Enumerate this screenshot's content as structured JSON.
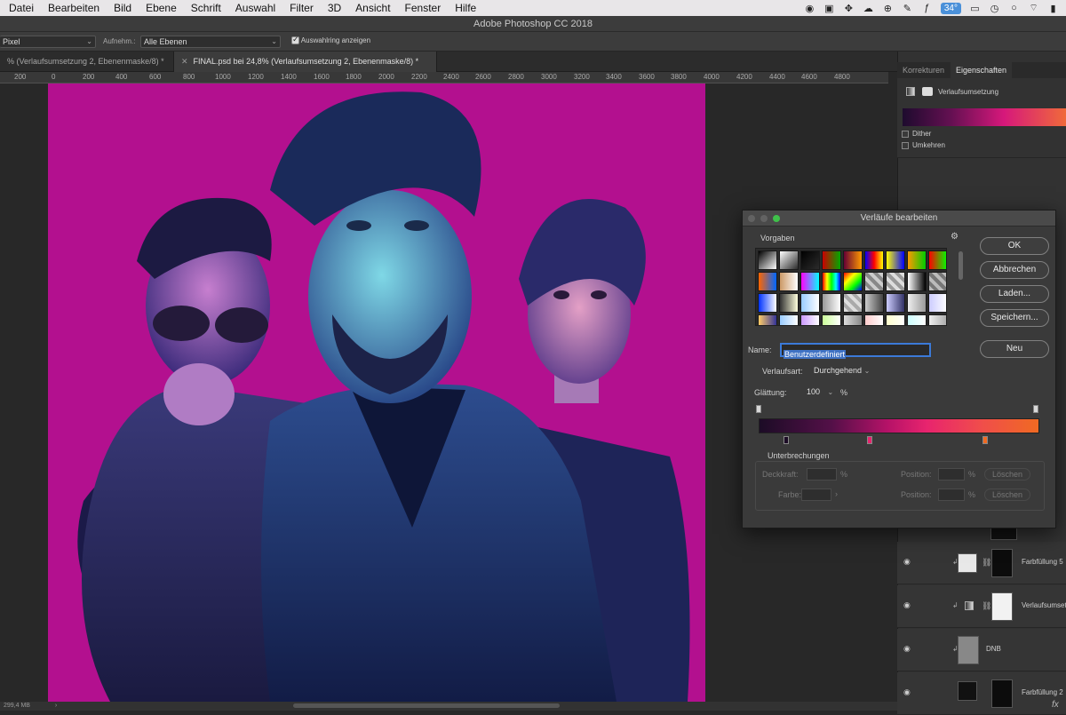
{
  "menubar": {
    "items": [
      "Datei",
      "Bearbeiten",
      "Bild",
      "Ebene",
      "Schrift",
      "Auswahl",
      "Filter",
      "3D",
      "Ansicht",
      "Fenster",
      "Hilfe"
    ],
    "temp": "34°"
  },
  "app_title": "Adobe Photoshop CC 2018",
  "options": {
    "unit": "Pixel",
    "sample_label": "Aufnehm.:",
    "sample_value": "Alle Ebenen",
    "show_ring": "Auswahlring anzeigen"
  },
  "tabs": [
    {
      "label": "% (Verlaufsumsetzung 2, Ebenenmaske/8) *",
      "active": false
    },
    {
      "label": "FINAL.psd bei 24,8% (Verlaufsumsetzung 2, Ebenenmaske/8) *",
      "active": true
    }
  ],
  "ruler": [
    "200",
    "0",
    "200",
    "400",
    "600",
    "800",
    "1000",
    "1200",
    "1400",
    "1600",
    "1800",
    "2000",
    "2200",
    "2400",
    "2600",
    "2800",
    "3000",
    "3200",
    "3400",
    "3600",
    "3800",
    "4000",
    "4200",
    "4400",
    "4600",
    "4800"
  ],
  "status": {
    "size": "299,4 MB",
    "arrow": "›"
  },
  "panel": {
    "tabs": [
      "Korrekturen",
      "Eigenschaften"
    ],
    "props_title": "Verlaufsumsetzung",
    "dither": "Dither",
    "reverse": "Umkehren",
    "layers": [
      {
        "name": "Farbfüllung 5"
      },
      {
        "name": "Verlaufsumset"
      },
      {
        "name": "DNB"
      },
      {
        "name": "Farbfüllung 2"
      }
    ],
    "fx": "fx"
  },
  "dialog": {
    "title": "Verläufe bearbeiten",
    "presets_label": "Vorgaben",
    "buttons": {
      "ok": "OK",
      "cancel": "Abbrechen",
      "load": "Laden...",
      "save": "Speichern...",
      "new": "Neu"
    },
    "name_label": "Name:",
    "name_value": "Benutzerdefiniert",
    "type_label": "Verlaufsart:",
    "type_value": "Durchgehend",
    "smooth_label": "Glättung:",
    "smooth_value": "100",
    "smooth_unit": "%",
    "stops_title": "Unterbrechungen",
    "opacity_label": "Deckkraft:",
    "color_label": "Farbe:",
    "position_label": "Position:",
    "pct": "%",
    "delete": "Löschen",
    "arrow": "›",
    "gradient_colors": [
      "#1c0c26",
      "#541048",
      "#b61268",
      "#e8246e",
      "#f04e4a",
      "#f06a22"
    ]
  }
}
